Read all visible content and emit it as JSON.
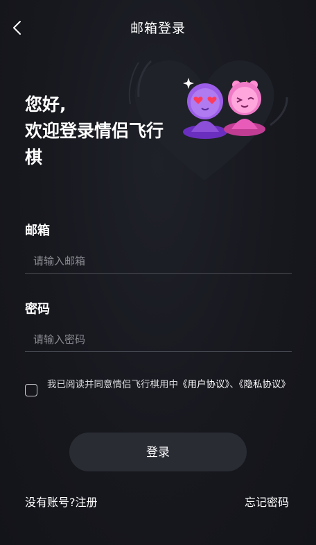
{
  "header": {
    "title": "邮箱登录",
    "back_icon": "chevron-left-icon"
  },
  "greeting": {
    "line1": "您好,",
    "line2": "欢迎登录情侣飞行",
    "line3": "棋"
  },
  "email": {
    "label": "邮箱",
    "placeholder": "请输入邮箱",
    "value": ""
  },
  "password": {
    "label": "密码",
    "placeholder": "请输入密码",
    "value": ""
  },
  "agreement": {
    "checked": false,
    "prefix": "我已阅读并同意情侣飞行棋用中",
    "user_agreement": "《用户协议》",
    "separator": "、",
    "privacy_agreement": "《隐私协议》"
  },
  "actions": {
    "login_label": "登录",
    "register_label": "没有账号?注册",
    "forgot_label": "忘记密码"
  },
  "colors": {
    "background": "#15161c",
    "button": "#2a2c34",
    "purple_mascot": "#8b4fd8",
    "pink_mascot": "#e85bb8"
  }
}
